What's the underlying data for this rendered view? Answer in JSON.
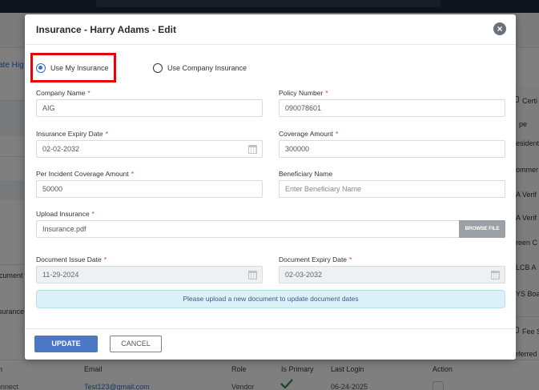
{
  "background": {
    "left_link": "ate Hig",
    "left_texts": [
      "ocument",
      "surance"
    ],
    "right_header": "Certi",
    "right_items": [
      "pe",
      "esident",
      "ommer",
      "A Verif",
      "A Verif",
      "reen C",
      "LCB A",
      "YS Boa"
    ],
    "right_fee": "Fee S",
    "right_referred": "eferred",
    "right_role_type": "Role Type",
    "table_headers": [
      "n",
      "Email",
      "Role",
      "Is Primary",
      "Last Login",
      "Action"
    ],
    "table_row": [
      "nnnect",
      "Test123@gmail.com",
      "Vendor",
      "06-24-2025"
    ]
  },
  "modal": {
    "title": "Insurance - Harry Adams - Edit",
    "close_icon": "×",
    "radio_my_insurance": "Use My Insurance",
    "radio_company_insurance": "Use Company Insurance",
    "selected_option": "Use My Insurance",
    "labels": {
      "company_name": "Company Name",
      "policy_number": "Policy Number",
      "expiry_date": "Insurance Expiry Date",
      "coverage_amount": "Coverage Amount",
      "per_incident": "Per Incident Coverage Amount",
      "beneficiary_name": "Beneficiary Name",
      "upload_insurance": "Upload Insurance",
      "document_issue_date": "Document Issue Date",
      "document_expiry_date": "Document Expiry Date"
    },
    "required_mark": "*",
    "values": {
      "company_name": "AIG",
      "policy_number": "090078601",
      "expiry_date": "02-02-2032",
      "coverage_amount": "300000",
      "per_incident": "50000",
      "upload_file": "Insurance.pdf",
      "document_issue_date": "11-29-2024",
      "document_expiry_date": "02-03-2032"
    },
    "placeholders": {
      "beneficiary_name": "Enter Beneficiary Name"
    },
    "browse_label": "BROWSE FILE",
    "info_message": "Please upload a new document to update document dates",
    "update_label": "UPDATE",
    "cancel_label": "CANCEL"
  },
  "colors": {
    "primary": "#4a78c4",
    "highlight": "#e8000b",
    "info_bg": "#dcf0f7",
    "required": "#e03a3a"
  }
}
